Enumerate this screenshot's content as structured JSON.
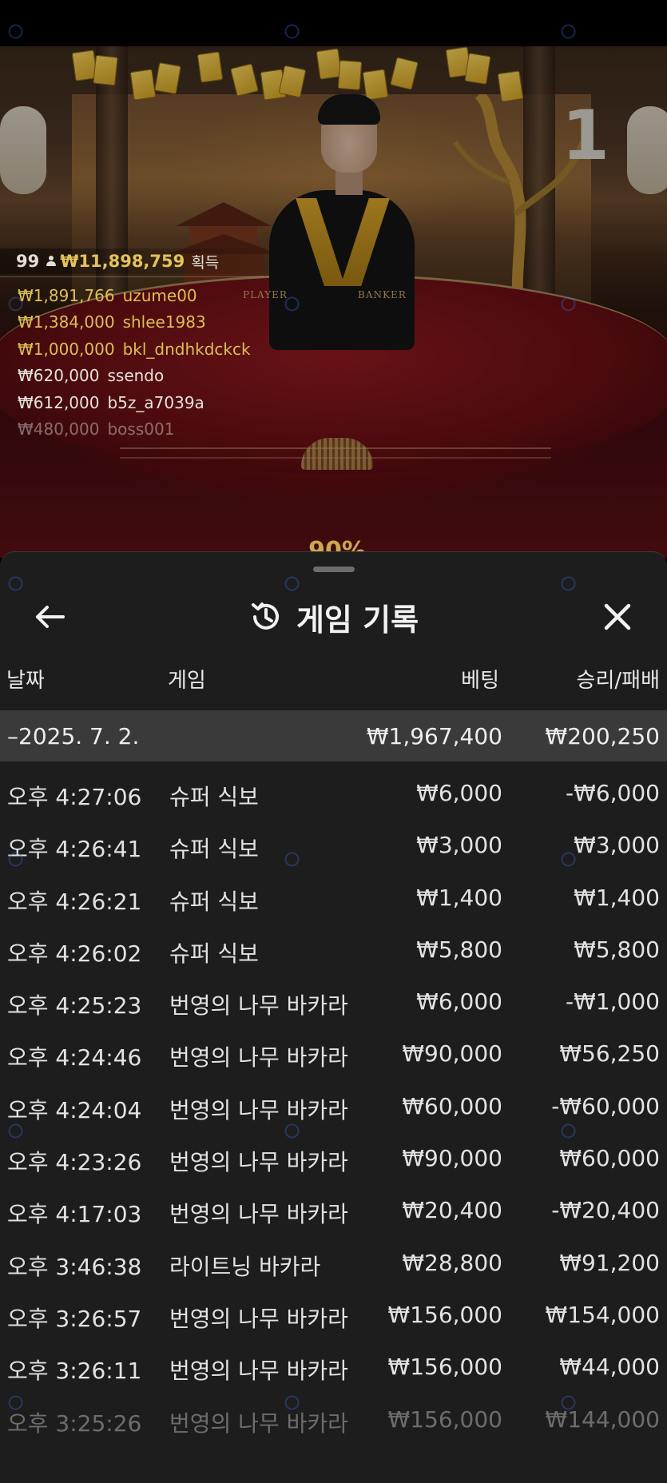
{
  "video": {
    "table_number": "1",
    "table_labels": {
      "player": "PLAYER",
      "banker": "BANKER"
    },
    "peek_text": "90%"
  },
  "winners": {
    "count": "99",
    "total": "₩11,898,759",
    "label": "획득",
    "list": [
      {
        "amount": "₩1,891,766",
        "name": "uzume00",
        "style": "gold"
      },
      {
        "amount": "₩1,384,000",
        "name": "shlee1983",
        "style": "gold"
      },
      {
        "amount": "₩1,000,000",
        "name": "bkl_dndhkdckck",
        "style": "gold"
      },
      {
        "amount": "₩620,000",
        "name": "ssendo",
        "style": "plain"
      },
      {
        "amount": "₩612,000",
        "name": "b5z_a7039a",
        "style": "plain"
      },
      {
        "amount": "₩480,000",
        "name": "boss001",
        "style": "fade"
      }
    ]
  },
  "sheet": {
    "title": "게임 기록",
    "icons": {
      "back": "arrow-left-icon",
      "history": "history-clock-icon",
      "close": "close-icon"
    },
    "columns": {
      "date": "날짜",
      "game": "게임",
      "bet": "베팅",
      "result": "승리/패배"
    },
    "summary": {
      "date": "–2025. 7. 2.",
      "bet": "₩1,967,400",
      "result": "₩200,250"
    },
    "rows": [
      {
        "time": "오후 4:27:06",
        "game": "슈퍼 식보",
        "bet": "₩6,000",
        "result": "-₩6,000"
      },
      {
        "time": "오후 4:26:41",
        "game": "슈퍼 식보",
        "bet": "₩3,000",
        "result": "₩3,000"
      },
      {
        "time": "오후 4:26:21",
        "game": "슈퍼 식보",
        "bet": "₩1,400",
        "result": "₩1,400"
      },
      {
        "time": "오후 4:26:02",
        "game": "슈퍼 식보",
        "bet": "₩5,800",
        "result": "₩5,800"
      },
      {
        "time": "오후 4:25:23",
        "game": "번영의 나무 바카라",
        "bet": "₩6,000",
        "result": "-₩1,000"
      },
      {
        "time": "오후 4:24:46",
        "game": "번영의 나무 바카라",
        "bet": "₩90,000",
        "result": "₩56,250"
      },
      {
        "time": "오후 4:24:04",
        "game": "번영의 나무 바카라",
        "bet": "₩60,000",
        "result": "-₩60,000"
      },
      {
        "time": "오후 4:23:26",
        "game": "번영의 나무 바카라",
        "bet": "₩90,000",
        "result": "₩60,000"
      },
      {
        "time": "오후 4:17:03",
        "game": "번영의 나무 바카라",
        "bet": "₩20,400",
        "result": "-₩20,400"
      },
      {
        "time": "오후 3:46:38",
        "game": "라이트닝 바카라",
        "bet": "₩28,800",
        "result": "₩91,200"
      },
      {
        "time": "오후 3:26:57",
        "game": "번영의 나무 바카라",
        "bet": "₩156,000",
        "result": "₩154,000"
      },
      {
        "time": "오후 3:26:11",
        "game": "번영의 나무 바카라",
        "bet": "₩156,000",
        "result": "₩44,000"
      },
      {
        "time": "오후 3:25:26",
        "game": "번영의 나무 바카라",
        "bet": "₩156,000",
        "result": "₩144,000"
      }
    ]
  },
  "colors": {
    "sheet_bg": "#1d1d1d",
    "summary_bg": "#3a3a3a",
    "gold_text": "#dcbf55",
    "watermark": "#3b6dd6"
  }
}
